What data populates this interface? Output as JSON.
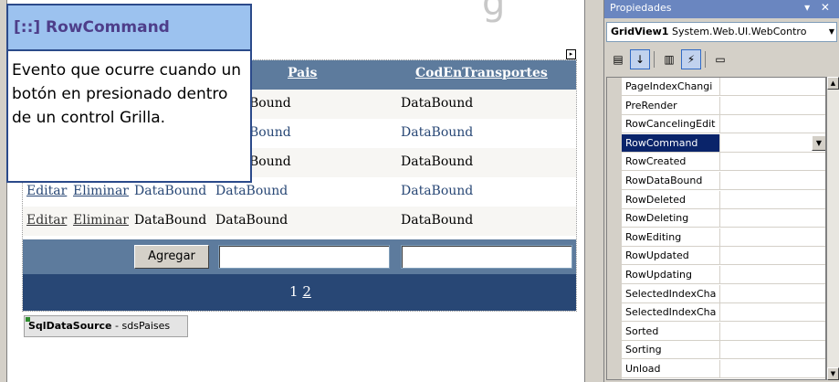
{
  "callout": {
    "title": "[::] RowCommand",
    "body": "Evento que ocurre cuando un botón en presionado dentro de un control Grilla."
  },
  "grid": {
    "headers": [
      "Pais",
      "CodEnTransportes"
    ],
    "rows": [
      {
        "edit": "",
        "delete": "",
        "c1": "",
        "c2": "Bound",
        "c3": "DataBound"
      },
      {
        "edit": "",
        "delete": "",
        "c1": "",
        "c2": "Bound",
        "c3": "DataBound"
      },
      {
        "edit": "",
        "delete": "",
        "c1": "",
        "c2": "Bound",
        "c3": "DataBound"
      },
      {
        "edit": "Editar",
        "delete": "Eliminar",
        "c1": "DataBound",
        "c2": "DataBound",
        "c3": "DataBound"
      },
      {
        "edit": "Editar",
        "delete": "Eliminar",
        "c1": "DataBound",
        "c2": "DataBound",
        "c3": "DataBound"
      }
    ],
    "add_button": "Agregar",
    "pager": {
      "current": "1",
      "next": "2"
    }
  },
  "datasource": {
    "type": "SqlDataSource",
    "separator": " - ",
    "id": "sdsPaises"
  },
  "properties": {
    "title": "Propiedades",
    "title_controls": "▾ ✕",
    "object_name": "GridView1",
    "object_type": "System.Web.UI.WebContro",
    "toolbar": [
      {
        "name": "categorized-icon",
        "glyph": "▤"
      },
      {
        "name": "alphabetical-icon",
        "glyph": "↓"
      },
      {
        "name": "properties-icon",
        "glyph": "▥"
      },
      {
        "name": "events-icon",
        "glyph": "⚡"
      },
      {
        "name": "property-pages-icon",
        "glyph": "▭"
      }
    ],
    "events": [
      "PageIndexChangi",
      "PreRender",
      "RowCancelingEdit",
      "RowCommand",
      "RowCreated",
      "RowDataBound",
      "RowDeleted",
      "RowDeleting",
      "RowEditing",
      "RowUpdated",
      "RowUpdating",
      "SelectedIndexCha",
      "SelectedIndexCha",
      "Sorted",
      "Sorting",
      "Unload"
    ],
    "selected_index": 3
  },
  "colors": {
    "header_bg": "#5d7b9d",
    "pager_bg": "#284775",
    "selection": "#0a246a",
    "callout_title_bg": "#9cc2ef"
  }
}
